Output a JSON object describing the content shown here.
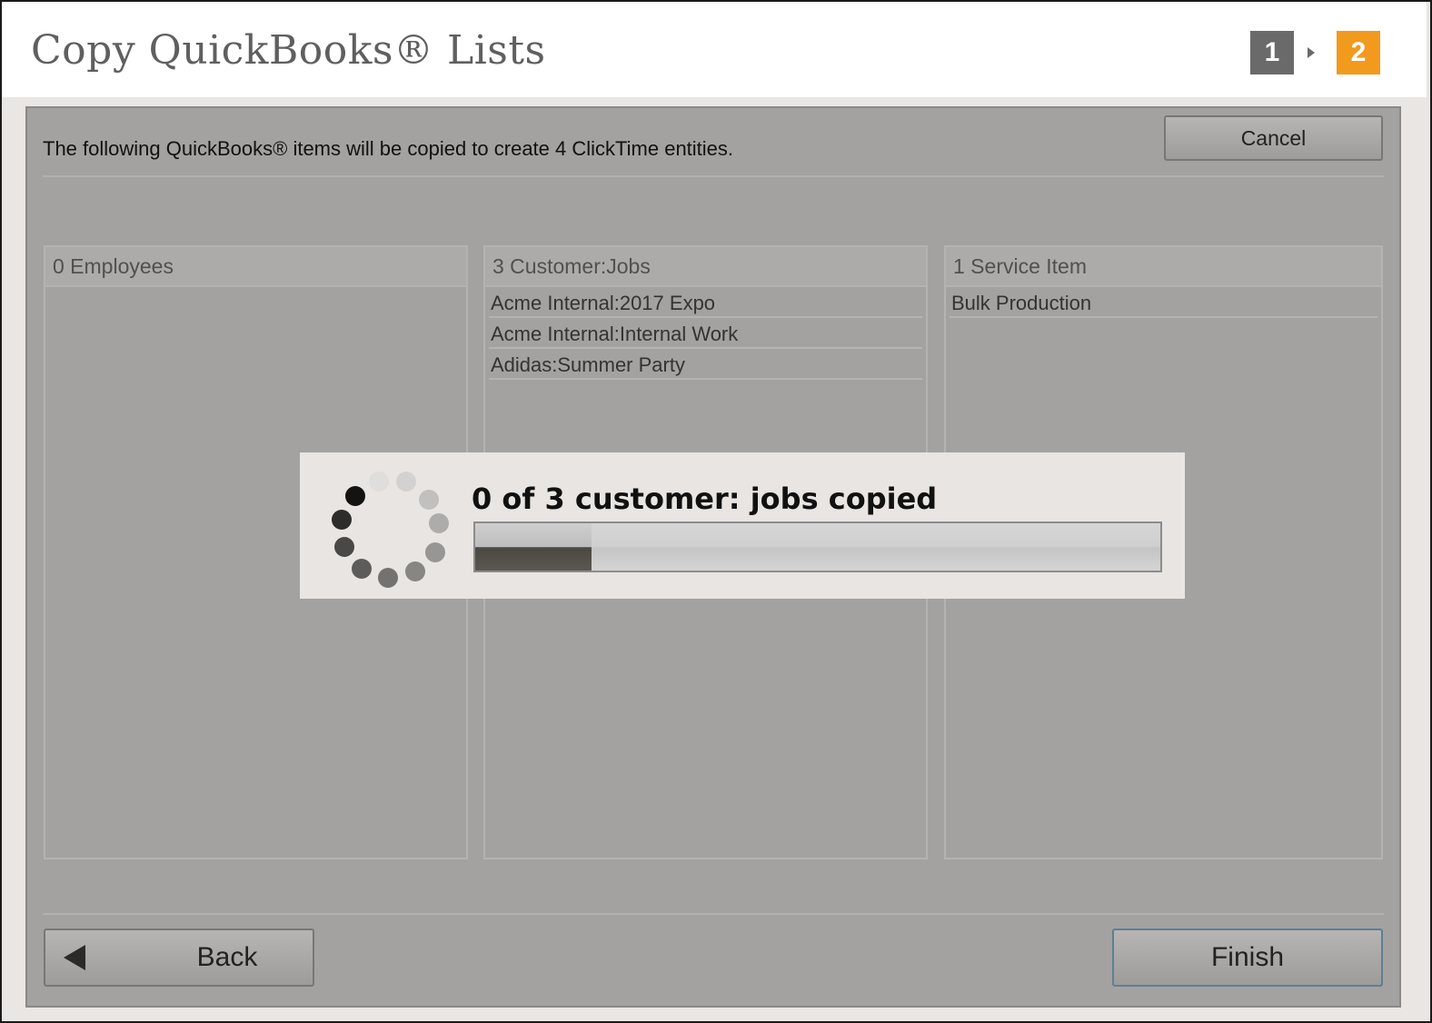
{
  "header": {
    "title": "Copy QuickBooks® Lists",
    "steps": [
      "1",
      "2"
    ],
    "active_step": "2"
  },
  "dialog": {
    "intro": "The following QuickBooks® items will be copied to create 4 ClickTime entities.",
    "cancel_label": "Cancel",
    "back_label": "Back",
    "finish_label": "Finish"
  },
  "columns": [
    {
      "header": "0 Employees",
      "items": []
    },
    {
      "header": "3 Customer:Jobs",
      "items": [
        "Acme Internal:2017 Expo",
        "Acme Internal:Internal Work",
        "Adidas:Summer Party"
      ]
    },
    {
      "header": "1 Service Item",
      "items": [
        "Bulk Production"
      ]
    }
  ],
  "progress": {
    "text": "0 of 3 customer: jobs copied",
    "fraction": 0.17
  },
  "colors": {
    "accent": "#f29a1e",
    "step_inactive": "#6a6a6a",
    "overlay_panel": "#a3a2a1"
  },
  "icons": {
    "spinner": "loading-spinner-icon",
    "back": "back-arrow-icon",
    "step_separator": "caret-right-icon"
  }
}
